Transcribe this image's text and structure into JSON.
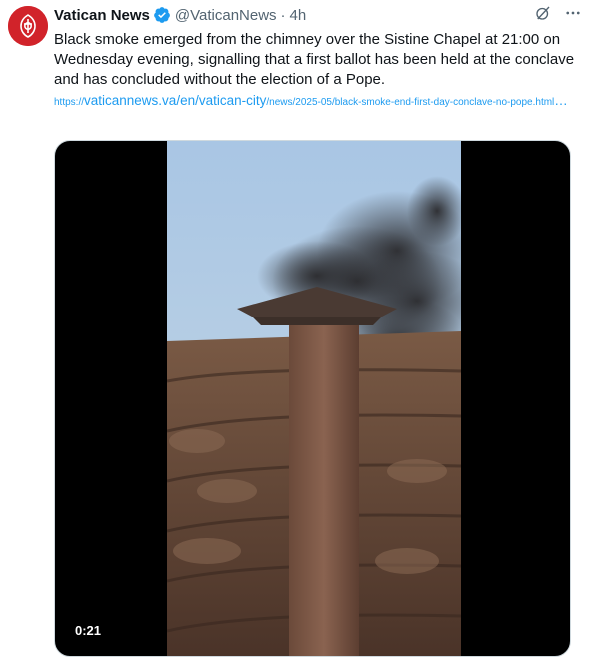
{
  "author": {
    "name": "Vatican News",
    "handle": "@VaticanNews",
    "separator": "·",
    "time": "4h",
    "avatar_icon": "vatican-news-logo",
    "verified_icon": "verified-badge-icon",
    "accent_color": "#d1232a"
  },
  "tweet": {
    "text": "Black smoke emerged from the chimney over the Sistine Chapel at 21:00 on Wednesday evening, signalling that a first ballot has been held at the conclave and has concluded without the election of a Pope.",
    "link_prefix": "https://",
    "link_domain": "vaticannews.va/en/vatican-city",
    "link_rest": "/news/2025-05/black-smoke-end-first-day-conclave-no-pope.html",
    "link_ellipsis": "…"
  },
  "media": {
    "type": "video",
    "duration": "0:21",
    "description_icon": "chimney-smoke-video"
  },
  "actions": {
    "grok_icon": "grok-icon",
    "more_icon": "more-icon"
  }
}
